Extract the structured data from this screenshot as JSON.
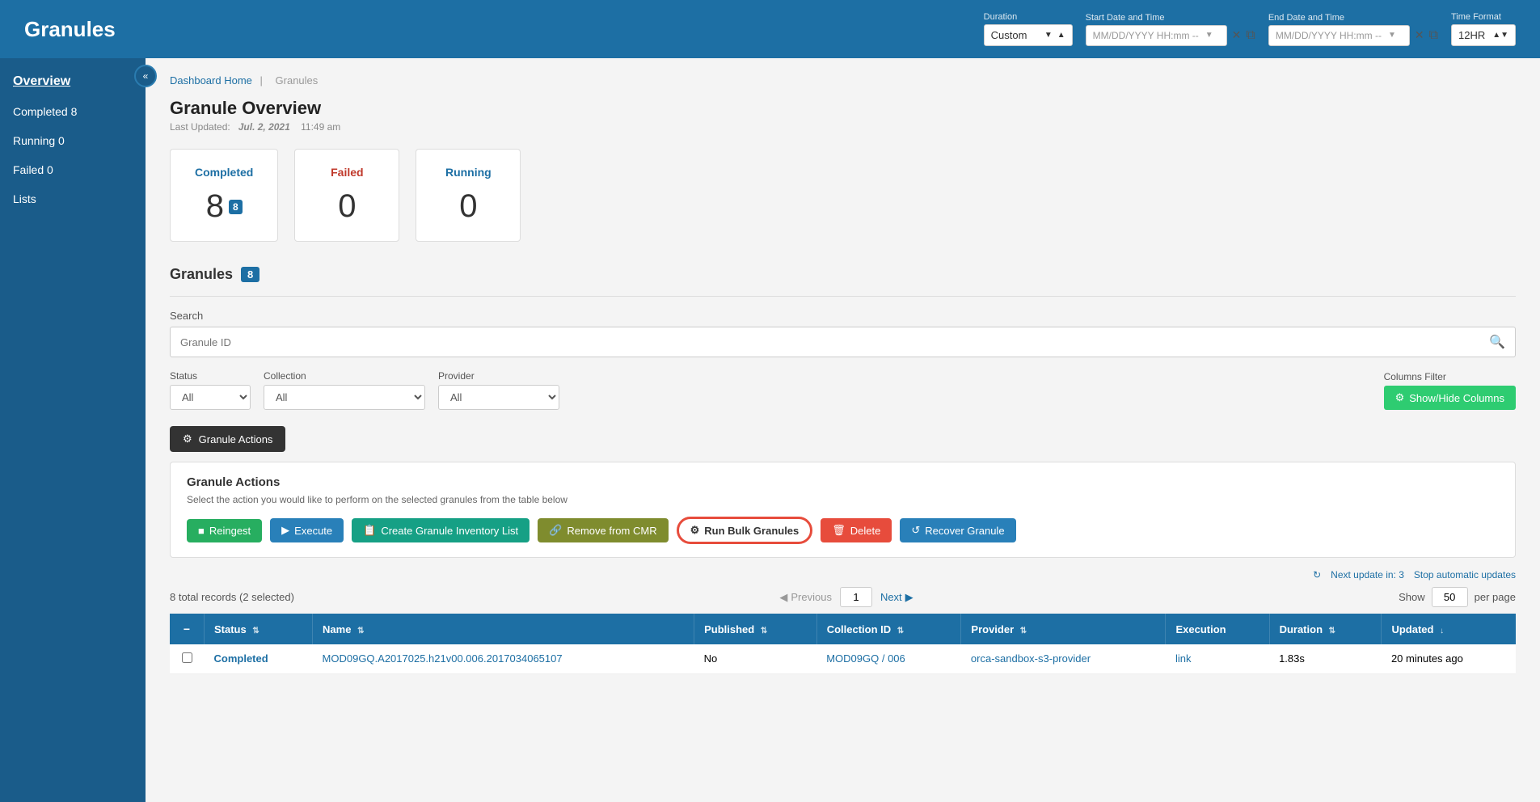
{
  "header": {
    "title": "Granules",
    "duration_label": "Duration",
    "duration_value": "Custom",
    "start_datetime_label": "Start Date and Time",
    "start_datetime_placeholder": "MM/DD/YYYY HH:mm --",
    "end_datetime_label": "End Date and Time",
    "end_datetime_placeholder": "MM/DD/YYYY HH:mm --",
    "time_format_label": "Time Format",
    "time_format_value": "12HR"
  },
  "sidebar": {
    "collapse_icon": "«",
    "overview_label": "Overview",
    "items": [
      {
        "id": "completed",
        "label": "Completed 8"
      },
      {
        "id": "running",
        "label": "Running 0"
      },
      {
        "id": "failed",
        "label": "Failed 0"
      },
      {
        "id": "lists",
        "label": "Lists"
      }
    ]
  },
  "breadcrumb": {
    "home": "Dashboard Home",
    "separator": "|",
    "current": "Granules"
  },
  "overview": {
    "title": "Granule Overview",
    "last_updated_label": "Last Updated:",
    "last_updated_date": "Jul. 2, 2021",
    "last_updated_time": "11:49 am",
    "stats": [
      {
        "id": "completed",
        "label": "Completed",
        "value": "8",
        "badge": "8",
        "type": "completed"
      },
      {
        "id": "failed",
        "label": "Failed",
        "value": "0",
        "type": "failed"
      },
      {
        "id": "running",
        "label": "Running",
        "value": "0",
        "type": "running"
      }
    ]
  },
  "granules_section": {
    "title": "Granules",
    "badge": "8",
    "search_label": "Search",
    "search_placeholder": "Granule ID",
    "status_label": "Status",
    "status_value": "All",
    "collection_label": "Collection",
    "collection_value": "All",
    "provider_label": "Provider",
    "provider_value": "All",
    "columns_filter_label": "Columns Filter",
    "show_hide_columns_btn": "Show/Hide Columns",
    "granule_actions_btn": "Granule Actions",
    "actions_panel": {
      "title": "Granule Actions",
      "description": "Select the action you would like to perform on the selected granules from the table below",
      "buttons": [
        {
          "id": "reingest",
          "label": "Reingest",
          "style": "green"
        },
        {
          "id": "execute",
          "label": "Execute",
          "style": "blue"
        },
        {
          "id": "create-inventory",
          "label": "Create Granule Inventory List",
          "style": "teal"
        },
        {
          "id": "remove-cmr",
          "label": "Remove from CMR",
          "style": "olive"
        },
        {
          "id": "run-bulk",
          "label": "Run Bulk Granules",
          "style": "run-bulk"
        },
        {
          "id": "delete",
          "label": "Delete",
          "style": "red"
        },
        {
          "id": "recover",
          "label": "Recover Granule",
          "style": "blue-recover"
        }
      ]
    },
    "next_update": "Next update in: 3",
    "stop_updates": "Stop automatic updates",
    "records_info": "8 total records (2 selected)",
    "pagination": {
      "previous_label": "Previous",
      "page": "1",
      "next_label": "Next"
    },
    "show_label": "Show",
    "per_page_label": "per page",
    "per_page_value": "50",
    "table": {
      "columns": [
        {
          "id": "checkbox",
          "label": ""
        },
        {
          "id": "status",
          "label": "Status",
          "sortable": true
        },
        {
          "id": "name",
          "label": "Name",
          "sortable": true
        },
        {
          "id": "published",
          "label": "Published",
          "sortable": true
        },
        {
          "id": "collection_id",
          "label": "Collection ID",
          "sortable": true
        },
        {
          "id": "provider",
          "label": "Provider",
          "sortable": true
        },
        {
          "id": "execution",
          "label": "Execution"
        },
        {
          "id": "duration",
          "label": "Duration",
          "sortable": true
        },
        {
          "id": "updated",
          "label": "Updated",
          "sortable": true
        }
      ],
      "rows": [
        {
          "checkbox": false,
          "status": "Completed",
          "name": "MOD09GQ.A2017025.h21v00.006.2017034065107",
          "published": "No",
          "collection_id": "MOD09GQ / 006",
          "provider": "orca-sandbox-s3-provider",
          "execution": "link",
          "duration": "1.83s",
          "updated": "20 minutes ago"
        }
      ]
    }
  }
}
